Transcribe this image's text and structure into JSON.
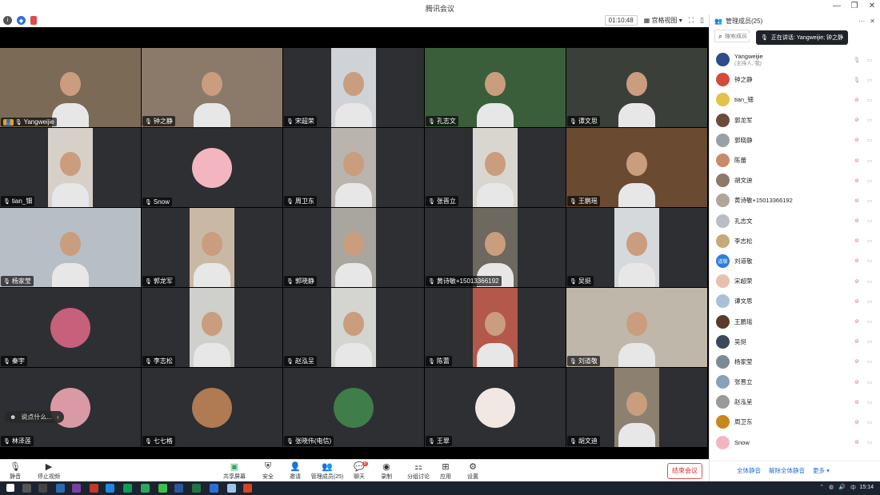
{
  "window": {
    "title": "腾讯会议"
  },
  "meetbar": {
    "timer": "01:10:48",
    "view_mode": "宫格视图"
  },
  "tiles": [
    {
      "name": "Yangweijie",
      "host": true,
      "cam": "wide",
      "bg": "#7b6a55"
    },
    {
      "name": "钟之静",
      "cam": "wide",
      "bg": "#8b7a6a"
    },
    {
      "name": "宋超荣",
      "cam": "narrow",
      "bg": "#cfd3d8"
    },
    {
      "name": "孔志文",
      "cam": "wide",
      "bg": "#3b5e3a"
    },
    {
      "name": "谭文思",
      "cam": "wide",
      "bg": "#3a3f3a"
    },
    {
      "name": "tian_钿",
      "cam": "narrow",
      "bg": "#d7d0c8"
    },
    {
      "name": "Snow",
      "avatar": "#f3b6c0"
    },
    {
      "name": "周卫东",
      "cam": "narrow",
      "bg": "#b9b4ad"
    },
    {
      "name": "张晋立",
      "cam": "narrow",
      "bg": "#d9d6cf"
    },
    {
      "name": "王鹏瑶",
      "cam": "wide",
      "bg": "#6b4a32"
    },
    {
      "name": "杨家莹",
      "cam": "wide",
      "bg": "#b8bec5"
    },
    {
      "name": "郭龙军",
      "cam": "narrow",
      "bg": "#c9b9a4"
    },
    {
      "name": "郭晓静",
      "cam": "narrow",
      "bg": "#a9a6a0"
    },
    {
      "name": "黄诗敏+15013366192",
      "cam": "narrow",
      "bg": "#6d6860"
    },
    {
      "name": "吴挺",
      "cam": "narrow",
      "bg": "#d6d9dc"
    },
    {
      "name": "秦宇",
      "avatar": "#c7607a"
    },
    {
      "name": "李志松",
      "cam": "narrow",
      "bg": "#cfcfcb"
    },
    {
      "name": "赵泓呈",
      "cam": "narrow",
      "bg": "#d4d4d0"
    },
    {
      "name": "陈蕾",
      "cam": "narrow",
      "bg": "#b4584a"
    },
    {
      "name": "刘道敬",
      "cam": "wide",
      "bg": "#bfb7aa"
    },
    {
      "name": "林泽莲",
      "avatar": "#d99aa6"
    },
    {
      "name": "七七格",
      "avatar": "#b07a52"
    },
    {
      "name": "张晓伟(电信)",
      "avatar": "#3f7d4a"
    },
    {
      "name": "王翠",
      "avatar": "#f1e7e3"
    },
    {
      "name": "胡文迪",
      "cam": "narrow",
      "bg": "#8c8170"
    }
  ],
  "chat_bubble": {
    "text": "说点什么..."
  },
  "bottombar": {
    "mute": "静音",
    "stop_video": "停止视频",
    "share": "共享屏幕",
    "security": "安全",
    "invite": "邀请",
    "members": "管理成员(25)",
    "chat": "聊天",
    "chat_badge": "8",
    "record": "录制",
    "breakout": "分组讨论",
    "apps": "应用",
    "settings": "设置",
    "end": "结束会议"
  },
  "panel": {
    "title": "管理成员(25)",
    "search_placeholder": "搜索成员",
    "speaking_tip": "正在讲话: Yangweijie; 钟之静",
    "mute_all": "全体静音",
    "unmute_all": "解除全体静音",
    "more": "更多 ▾",
    "members": [
      {
        "name": "Yangweijie",
        "sub": "(主持人, 我)",
        "color": "#2e4b8a",
        "mic_on": true
      },
      {
        "name": "钟之静",
        "color": "#d54b3a",
        "mic_on": true
      },
      {
        "name": "tian_钿",
        "color": "#e3c24b"
      },
      {
        "name": "郭龙军",
        "color": "#6d4a3a"
      },
      {
        "name": "郭晓静",
        "color": "#9aa0a8"
      },
      {
        "name": "陈蕾",
        "color": "#c98a6a"
      },
      {
        "name": "胡文迪",
        "color": "#8a7a6a"
      },
      {
        "name": "黄诗敏+15013366192",
        "color": "#b2a59a"
      },
      {
        "name": "孔志文",
        "color": "#b9bec4"
      },
      {
        "name": "李志松",
        "color": "#c6a87a"
      },
      {
        "name": "刘道敬",
        "color": "#2f7de0",
        "initial": "道敬"
      },
      {
        "name": "宋超荣",
        "color": "#e5c2b0"
      },
      {
        "name": "谭文思",
        "color": "#a9c1d8"
      },
      {
        "name": "王鹏瑶",
        "color": "#5a3a2a"
      },
      {
        "name": "吴挺",
        "color": "#3a4a5a"
      },
      {
        "name": "杨家莹",
        "color": "#7d8b96"
      },
      {
        "name": "张晋立",
        "color": "#8aa0b8"
      },
      {
        "name": "赵泓呈",
        "color": "#9a9a9a"
      },
      {
        "name": "周卫东",
        "color": "#c8871a"
      },
      {
        "name": "Snow",
        "color": "#f3b6c0"
      }
    ]
  },
  "taskbar": {
    "time": "15:14",
    "ime": "中"
  }
}
